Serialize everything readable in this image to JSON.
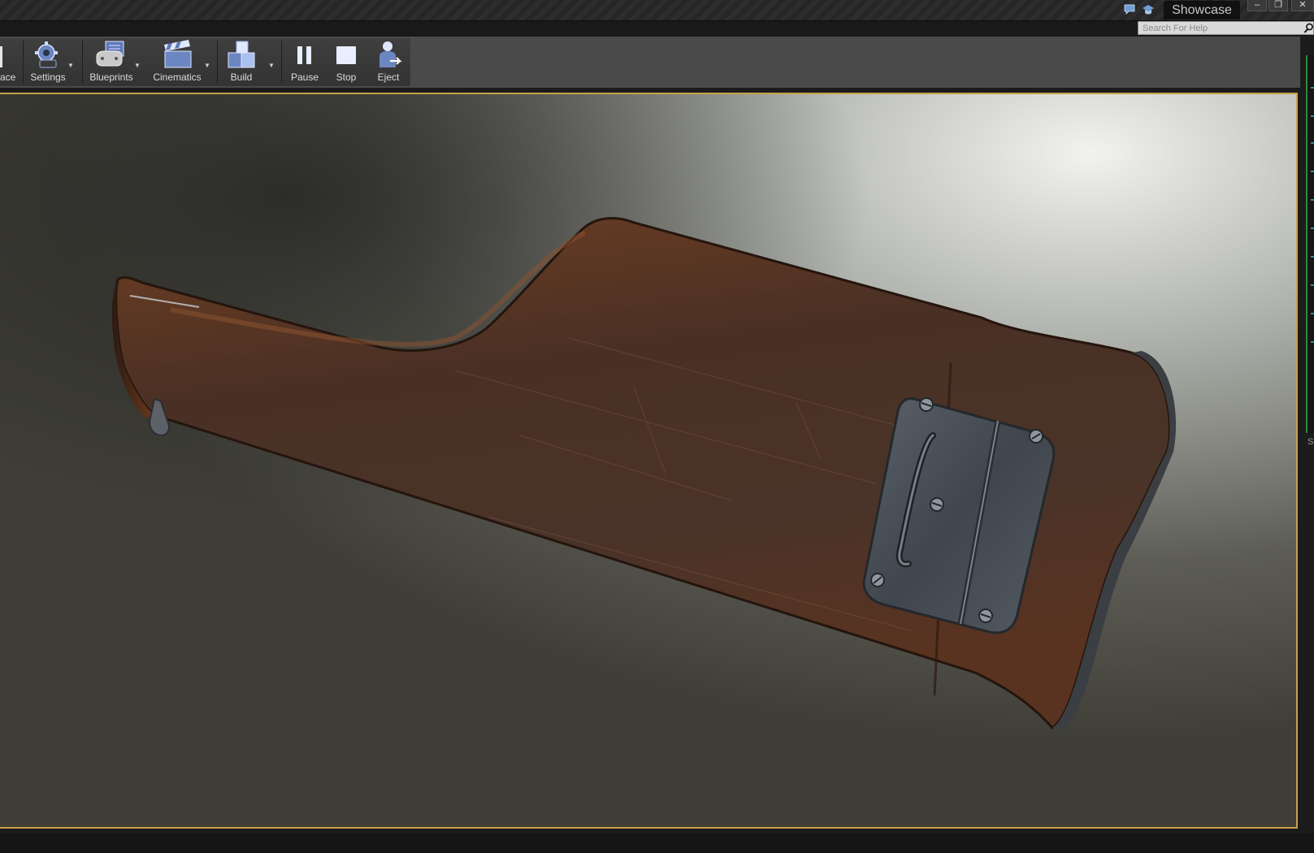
{
  "window": {
    "project_tab": "Showcase",
    "controls": {
      "minimize": "–",
      "restore": "❐",
      "close": "✕"
    }
  },
  "search": {
    "placeholder": "Search For Help"
  },
  "toolbar": {
    "items": [
      {
        "label": "ace",
        "icon": "marketplace-icon"
      },
      {
        "label": "Settings",
        "icon": "gear-icon",
        "has_dropdown": true
      },
      {
        "label": "Blueprints",
        "icon": "blueprints-icon",
        "has_dropdown": true
      },
      {
        "label": "Cinematics",
        "icon": "clapperboard-icon",
        "has_dropdown": true
      },
      {
        "label": "Build",
        "icon": "build-blocks-icon",
        "has_dropdown": true
      },
      {
        "label": "Pause",
        "icon": "pause-icon"
      },
      {
        "label": "Stop",
        "icon": "stop-icon"
      },
      {
        "label": "Eject",
        "icon": "eject-icon"
      }
    ],
    "dropdown_glyph": "▼"
  },
  "right_panel": {
    "letter": "S"
  },
  "colors": {
    "viewport_border": "#c8a04a",
    "accent_green": "#2e8a3b",
    "wood_dark": "#3b2417",
    "wood_light": "#7a4527",
    "metal": "#4d5258"
  }
}
